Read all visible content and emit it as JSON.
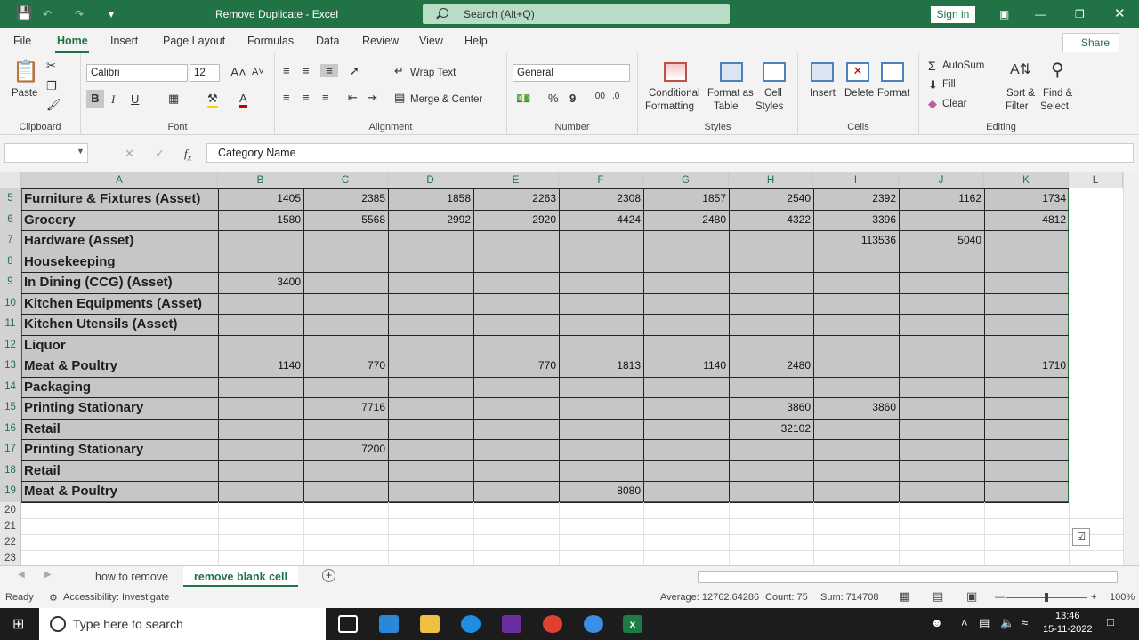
{
  "window": {
    "title": "Remove Duplicate  -  Excel",
    "search_placeholder": "Search (Alt+Q)",
    "signin": "Sign in"
  },
  "menu": {
    "items": [
      "File",
      "Home",
      "Insert",
      "Page Layout",
      "Formulas",
      "Data",
      "Review",
      "View",
      "Help"
    ],
    "share": "Share"
  },
  "ribbon": {
    "clipboard": {
      "paste": "Paste",
      "label": "Clipboard"
    },
    "font": {
      "name": "Calibri",
      "size": "12",
      "label": "Font"
    },
    "alignment": {
      "wrap": "Wrap Text",
      "merge": "Merge & Center",
      "label": "Alignment"
    },
    "number": {
      "format": "General",
      "label": "Number"
    },
    "styles": {
      "cond1": "Conditional",
      "cond2": "Formatting",
      "fmt1": "Format as",
      "fmt2": "Table",
      "cell1": "Cell",
      "cell2": "Styles",
      "label": "Styles"
    },
    "cells": {
      "insert": "Insert",
      "delete": "Delete",
      "format": "Format",
      "label": "Cells"
    },
    "editing": {
      "autosum": "AutoSum",
      "fill": "Fill",
      "clear": "Clear",
      "sort1": "Sort &",
      "sort2": "Filter",
      "find1": "Find &",
      "find2": "Select",
      "label": "Editing"
    }
  },
  "formula": {
    "name_box": "",
    "content": "Category Name"
  },
  "columns": [
    "A",
    "B",
    "C",
    "D",
    "E",
    "F",
    "G",
    "H",
    "I",
    "J",
    "K",
    "L"
  ],
  "rows": [
    {
      "num": "5",
      "name": "Furniture & Fixtures (Asset)",
      "vals": [
        "1405",
        "2385",
        "1858",
        "2263",
        "2308",
        "1857",
        "2540",
        "2392",
        "1162",
        "1734"
      ]
    },
    {
      "num": "6",
      "name": "Grocery",
      "vals": [
        "1580",
        "5568",
        "2992",
        "2920",
        "4424",
        "2480",
        "4322",
        "3396",
        "",
        "4812"
      ]
    },
    {
      "num": "7",
      "name": "Hardware (Asset)",
      "vals": [
        "",
        "",
        "",
        "",
        "",
        "",
        "",
        "113536",
        "5040",
        ""
      ]
    },
    {
      "num": "8",
      "name": "Housekeeping",
      "vals": [
        "",
        "",
        "",
        "",
        "",
        "",
        "",
        "",
        "",
        ""
      ]
    },
    {
      "num": "9",
      "name": "In Dining (CCG) (Asset)",
      "vals": [
        "3400",
        "",
        "",
        "",
        "",
        "",
        "",
        "",
        "",
        ""
      ]
    },
    {
      "num": "10",
      "name": "Kitchen Equipments (Asset)",
      "vals": [
        "",
        "",
        "",
        "",
        "",
        "",
        "",
        "",
        "",
        ""
      ]
    },
    {
      "num": "11",
      "name": "Kitchen Utensils (Asset)",
      "vals": [
        "",
        "",
        "",
        "",
        "",
        "",
        "",
        "",
        "",
        ""
      ]
    },
    {
      "num": "12",
      "name": "Liquor",
      "vals": [
        "",
        "",
        "",
        "",
        "",
        "",
        "",
        "",
        "",
        ""
      ]
    },
    {
      "num": "13",
      "name": "Meat & Poultry",
      "vals": [
        "1140",
        "770",
        "",
        "770",
        "1813",
        "1140",
        "2480",
        "",
        "",
        "1710"
      ]
    },
    {
      "num": "14",
      "name": "Packaging",
      "vals": [
        "",
        "",
        "",
        "",
        "",
        "",
        "",
        "",
        "",
        ""
      ]
    },
    {
      "num": "15",
      "name": "Printing Stationary",
      "vals": [
        "",
        "7716",
        "",
        "",
        "",
        "",
        "3860",
        "3860",
        "",
        ""
      ]
    },
    {
      "num": "16",
      "name": "Retail",
      "vals": [
        "",
        "",
        "",
        "",
        "",
        "",
        "32102",
        "",
        "",
        ""
      ]
    },
    {
      "num": "17",
      "name": "Printing Stationary",
      "vals": [
        "",
        "7200",
        "",
        "",
        "",
        "",
        "",
        "",
        "",
        ""
      ]
    },
    {
      "num": "18",
      "name": "Retail",
      "vals": [
        "",
        "",
        "",
        "",
        "",
        "",
        "",
        "",
        "",
        ""
      ]
    },
    {
      "num": "19",
      "name": "Meat & Poultry",
      "vals": [
        "",
        "",
        "",
        "",
        "8080",
        "",
        "",
        "",
        "",
        ""
      ]
    }
  ],
  "extra_rows": [
    "20",
    "21",
    "22",
    "23"
  ],
  "sheets": {
    "tab1": "how to remove",
    "tab2": "remove blank cell"
  },
  "status": {
    "ready": "Ready",
    "accessibility": "Accessibility: Investigate",
    "average": "Average: 12762.64286",
    "count": "Count: 75",
    "sum": "Sum: 714708",
    "zoom": "100%"
  },
  "taskbar": {
    "search": "Type here to search",
    "time": "13:46",
    "date": "15-11-2022"
  }
}
